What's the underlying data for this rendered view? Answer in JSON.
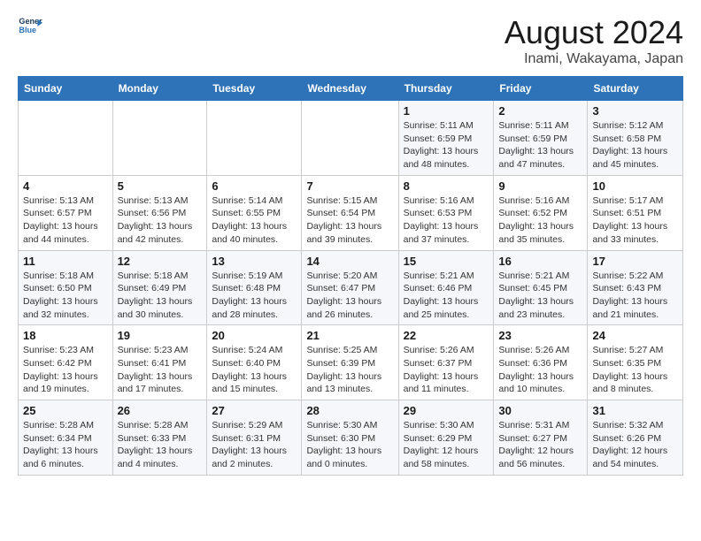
{
  "header": {
    "logo_line1": "General",
    "logo_line2": "Blue",
    "month_year": "August 2024",
    "location": "Inami, Wakayama, Japan"
  },
  "weekdays": [
    "Sunday",
    "Monday",
    "Tuesday",
    "Wednesday",
    "Thursday",
    "Friday",
    "Saturday"
  ],
  "weeks": [
    [
      {
        "day": "",
        "info": ""
      },
      {
        "day": "",
        "info": ""
      },
      {
        "day": "",
        "info": ""
      },
      {
        "day": "",
        "info": ""
      },
      {
        "day": "1",
        "info": "Sunrise: 5:11 AM\nSunset: 6:59 PM\nDaylight: 13 hours\nand 48 minutes."
      },
      {
        "day": "2",
        "info": "Sunrise: 5:11 AM\nSunset: 6:59 PM\nDaylight: 13 hours\nand 47 minutes."
      },
      {
        "day": "3",
        "info": "Sunrise: 5:12 AM\nSunset: 6:58 PM\nDaylight: 13 hours\nand 45 minutes."
      }
    ],
    [
      {
        "day": "4",
        "info": "Sunrise: 5:13 AM\nSunset: 6:57 PM\nDaylight: 13 hours\nand 44 minutes."
      },
      {
        "day": "5",
        "info": "Sunrise: 5:13 AM\nSunset: 6:56 PM\nDaylight: 13 hours\nand 42 minutes."
      },
      {
        "day": "6",
        "info": "Sunrise: 5:14 AM\nSunset: 6:55 PM\nDaylight: 13 hours\nand 40 minutes."
      },
      {
        "day": "7",
        "info": "Sunrise: 5:15 AM\nSunset: 6:54 PM\nDaylight: 13 hours\nand 39 minutes."
      },
      {
        "day": "8",
        "info": "Sunrise: 5:16 AM\nSunset: 6:53 PM\nDaylight: 13 hours\nand 37 minutes."
      },
      {
        "day": "9",
        "info": "Sunrise: 5:16 AM\nSunset: 6:52 PM\nDaylight: 13 hours\nand 35 minutes."
      },
      {
        "day": "10",
        "info": "Sunrise: 5:17 AM\nSunset: 6:51 PM\nDaylight: 13 hours\nand 33 minutes."
      }
    ],
    [
      {
        "day": "11",
        "info": "Sunrise: 5:18 AM\nSunset: 6:50 PM\nDaylight: 13 hours\nand 32 minutes."
      },
      {
        "day": "12",
        "info": "Sunrise: 5:18 AM\nSunset: 6:49 PM\nDaylight: 13 hours\nand 30 minutes."
      },
      {
        "day": "13",
        "info": "Sunrise: 5:19 AM\nSunset: 6:48 PM\nDaylight: 13 hours\nand 28 minutes."
      },
      {
        "day": "14",
        "info": "Sunrise: 5:20 AM\nSunset: 6:47 PM\nDaylight: 13 hours\nand 26 minutes."
      },
      {
        "day": "15",
        "info": "Sunrise: 5:21 AM\nSunset: 6:46 PM\nDaylight: 13 hours\nand 25 minutes."
      },
      {
        "day": "16",
        "info": "Sunrise: 5:21 AM\nSunset: 6:45 PM\nDaylight: 13 hours\nand 23 minutes."
      },
      {
        "day": "17",
        "info": "Sunrise: 5:22 AM\nSunset: 6:43 PM\nDaylight: 13 hours\nand 21 minutes."
      }
    ],
    [
      {
        "day": "18",
        "info": "Sunrise: 5:23 AM\nSunset: 6:42 PM\nDaylight: 13 hours\nand 19 minutes."
      },
      {
        "day": "19",
        "info": "Sunrise: 5:23 AM\nSunset: 6:41 PM\nDaylight: 13 hours\nand 17 minutes."
      },
      {
        "day": "20",
        "info": "Sunrise: 5:24 AM\nSunset: 6:40 PM\nDaylight: 13 hours\nand 15 minutes."
      },
      {
        "day": "21",
        "info": "Sunrise: 5:25 AM\nSunset: 6:39 PM\nDaylight: 13 hours\nand 13 minutes."
      },
      {
        "day": "22",
        "info": "Sunrise: 5:26 AM\nSunset: 6:37 PM\nDaylight: 13 hours\nand 11 minutes."
      },
      {
        "day": "23",
        "info": "Sunrise: 5:26 AM\nSunset: 6:36 PM\nDaylight: 13 hours\nand 10 minutes."
      },
      {
        "day": "24",
        "info": "Sunrise: 5:27 AM\nSunset: 6:35 PM\nDaylight: 13 hours\nand 8 minutes."
      }
    ],
    [
      {
        "day": "25",
        "info": "Sunrise: 5:28 AM\nSunset: 6:34 PM\nDaylight: 13 hours\nand 6 minutes."
      },
      {
        "day": "26",
        "info": "Sunrise: 5:28 AM\nSunset: 6:33 PM\nDaylight: 13 hours\nand 4 minutes."
      },
      {
        "day": "27",
        "info": "Sunrise: 5:29 AM\nSunset: 6:31 PM\nDaylight: 13 hours\nand 2 minutes."
      },
      {
        "day": "28",
        "info": "Sunrise: 5:30 AM\nSunset: 6:30 PM\nDaylight: 13 hours\nand 0 minutes."
      },
      {
        "day": "29",
        "info": "Sunrise: 5:30 AM\nSunset: 6:29 PM\nDaylight: 12 hours\nand 58 minutes."
      },
      {
        "day": "30",
        "info": "Sunrise: 5:31 AM\nSunset: 6:27 PM\nDaylight: 12 hours\nand 56 minutes."
      },
      {
        "day": "31",
        "info": "Sunrise: 5:32 AM\nSunset: 6:26 PM\nDaylight: 12 hours\nand 54 minutes."
      }
    ]
  ]
}
